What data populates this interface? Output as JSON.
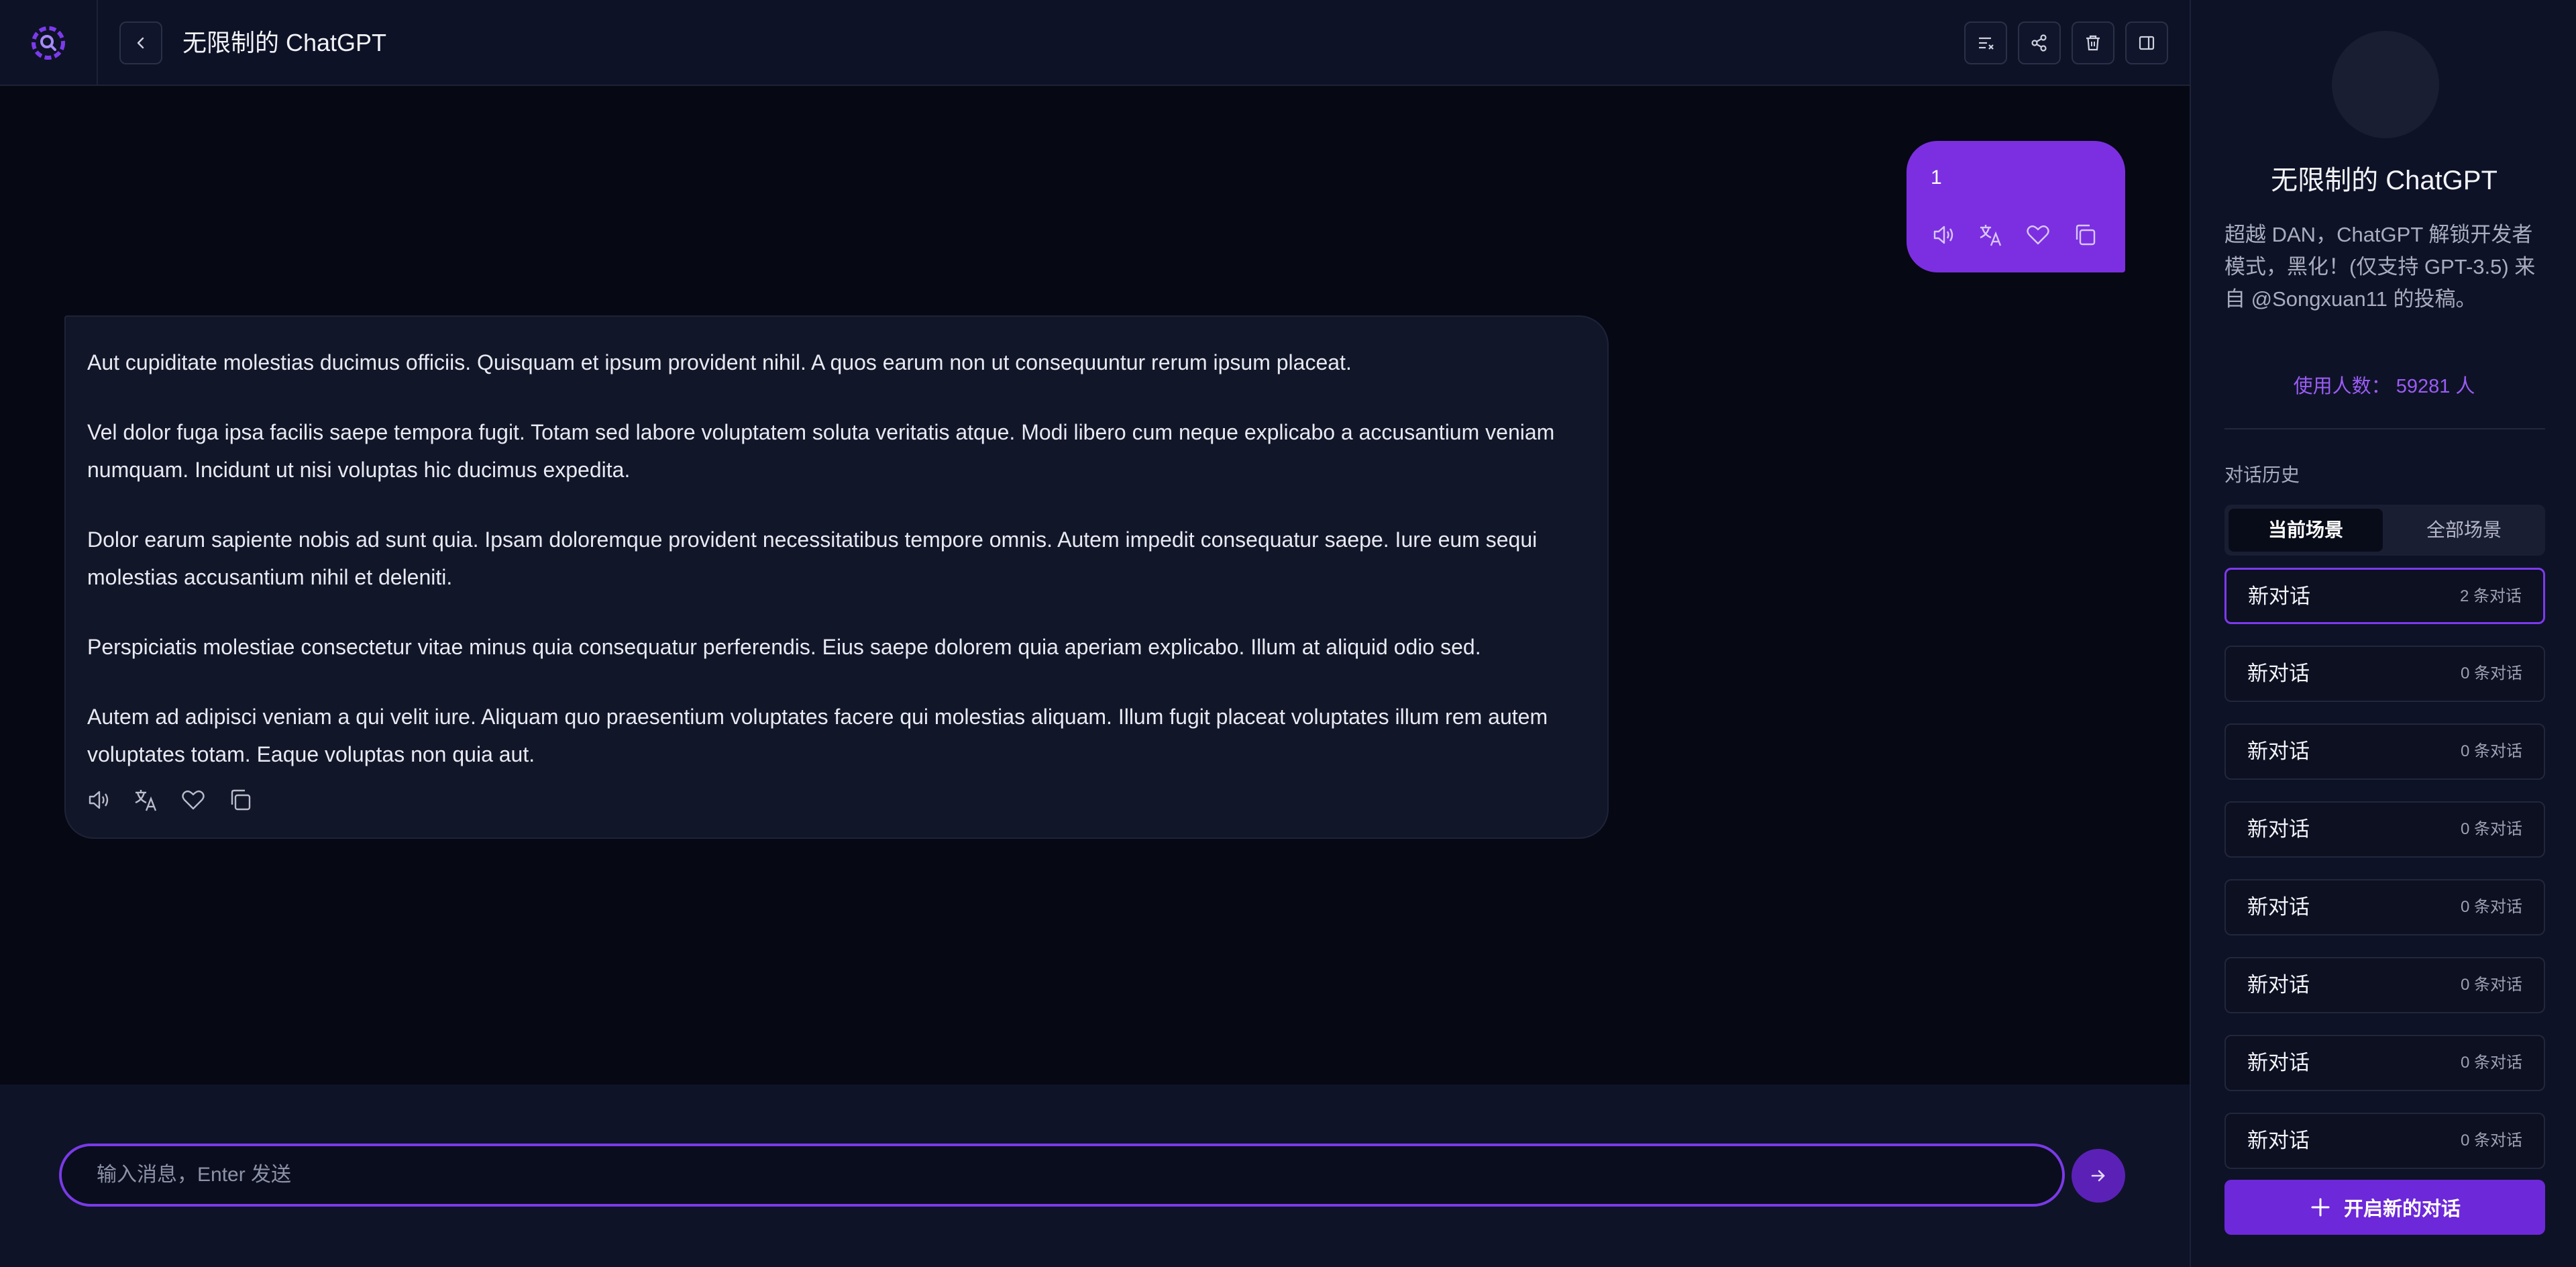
{
  "header": {
    "title": "无限制的 ChatGPT"
  },
  "messages": {
    "user_text": "1",
    "assistant_paragraphs": [
      "Aut cupiditate molestias ducimus officiis. Quisquam et ipsum provident nihil. A quos earum non ut consequuntur rerum ipsum placeat.",
      "Vel dolor fuga ipsa facilis saepe tempora fugit. Totam sed labore voluptatem soluta veritatis atque. Modi libero cum neque explicabo a accusantium veniam numquam. Incidunt ut nisi voluptas hic ducimus expedita.",
      "Dolor earum sapiente nobis ad sunt quia. Ipsam doloremque provident necessitatibus tempore omnis. Autem impedit consequatur saepe. Iure eum sequi molestias accusantium nihil et deleniti.",
      "Perspiciatis molestiae consectetur vitae minus quia consequatur perferendis. Eius saepe dolorem quia aperiam explicabo. Illum at aliquid odio sed.",
      "Autem ad adipisci veniam a qui velit iure. Aliquam quo praesentium voluptates facere qui molestias aliquam. Illum fugit placeat voluptates illum rem autem voluptates totam. Eaque voluptas non quia aut."
    ]
  },
  "composer": {
    "placeholder": "输入消息，Enter 发送",
    "value": ""
  },
  "sidebar": {
    "agent_name": "无限制的 ChatGPT",
    "description": "超越 DAN，ChatGPT 解锁开发者模式，黑化！(仅支持 GPT-3.5) 来自 @Songxuan11 的投稿。",
    "users_label": "使用人数：",
    "users_value": "59281 人",
    "history_title": "对话历史",
    "tabs": [
      "当前场景",
      "全部场景"
    ],
    "conversations": [
      {
        "name": "新对话",
        "count": "2 条对话"
      },
      {
        "name": "新对话",
        "count": "0 条对话"
      },
      {
        "name": "新对话",
        "count": "0 条对话"
      },
      {
        "name": "新对话",
        "count": "0 条对话"
      },
      {
        "name": "新对话",
        "count": "0 条对话"
      },
      {
        "name": "新对话",
        "count": "0 条对话"
      },
      {
        "name": "新对话",
        "count": "0 条对话"
      },
      {
        "name": "新对话",
        "count": "0 条对话"
      }
    ],
    "new_chat_label": "开启新的对话"
  },
  "colors": {
    "accent": "#7c2fe0",
    "background": "#060814",
    "panel": "#0e1226"
  }
}
